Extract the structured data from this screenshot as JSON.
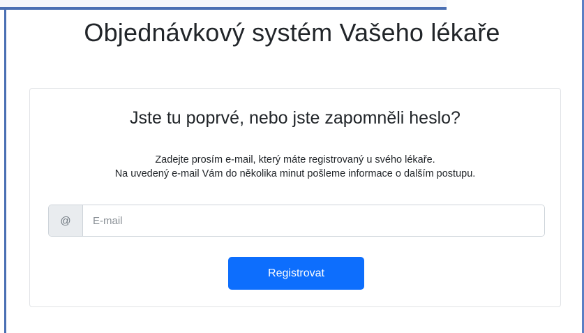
{
  "page": {
    "title": "Objednávkový systém Vašeho lékaře"
  },
  "card": {
    "title": "Jste tu poprvé, nebo jste zapomněli heslo?",
    "instructions_line1": "Zadejte prosím e-mail, který máte registrovaný u svého lékaře.",
    "instructions_line2": "Na uvedený e-mail Vám do několika minut pošleme informace o dalším postupu."
  },
  "form": {
    "email_prefix": "@",
    "email_placeholder": "E-mail",
    "email_value": "",
    "submit_label": "Registrovat"
  },
  "colors": {
    "primary": "#0d6efd",
    "frame": "#4a6fb3"
  }
}
